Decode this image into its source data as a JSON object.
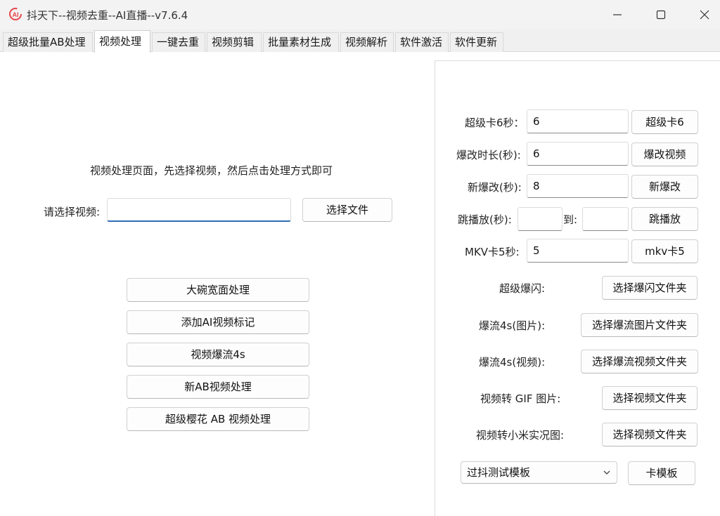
{
  "window": {
    "title": "抖天下--视频去重--AI直播--v7.6.4",
    "icon": "ai-logo-icon"
  },
  "tabs": [
    {
      "label": "超级批量AB处理"
    },
    {
      "label": "视频处理",
      "active": true
    },
    {
      "label": "一键去重"
    },
    {
      "label": "视频剪辑"
    },
    {
      "label": "批量素材生成"
    },
    {
      "label": "视频解析"
    },
    {
      "label": "软件激活"
    },
    {
      "label": "软件更新"
    }
  ],
  "left": {
    "hint": "视频处理页面，先选择视频，然后点击处理方式即可",
    "select_label": "请选择视频:",
    "select_value": "",
    "choose_file": "选择文件",
    "actions": [
      "大碗宽面处理",
      "添加AI视频标记",
      "视频爆流4s",
      "新AB视频处理",
      "超级樱花 AB 视频处理"
    ]
  },
  "right": {
    "super_card": {
      "label": "超级卡6秒：",
      "value": "6",
      "button": "超级卡6"
    },
    "burst_duration": {
      "label": "爆改时长(秒):",
      "value": "6",
      "button": "爆改视频"
    },
    "new_burst": {
      "label": "新爆改(秒):",
      "value": "8",
      "button": "新爆改"
    },
    "skip_play": {
      "label": "跳播放(秒):",
      "from": "",
      "to_label": "到:",
      "to": "",
      "button": "跳播放"
    },
    "mkv_card": {
      "label": "MKV卡5秒:",
      "value": "5",
      "button": "mkv卡5"
    },
    "super_flash": {
      "label": "超级爆闪:",
      "button": "选择爆闪文件夹"
    },
    "flow_image": {
      "label": "爆流4s(图片):",
      "button": "选择爆流图片文件夹"
    },
    "flow_video": {
      "label": "爆流4s(视频):",
      "button": "选择爆流视频文件夹"
    },
    "to_gif": {
      "label": "视频转 GIF 图片:",
      "button": "选择视频文件夹"
    },
    "to_xiaomi": {
      "label": "视频转小米实况图:",
      "button": "选择视频文件夹"
    },
    "template": {
      "selected": "过抖测试模板",
      "button": "卡模板"
    }
  },
  "colors": {
    "accent": "#2f6fb5",
    "logo": "#e8474a"
  }
}
